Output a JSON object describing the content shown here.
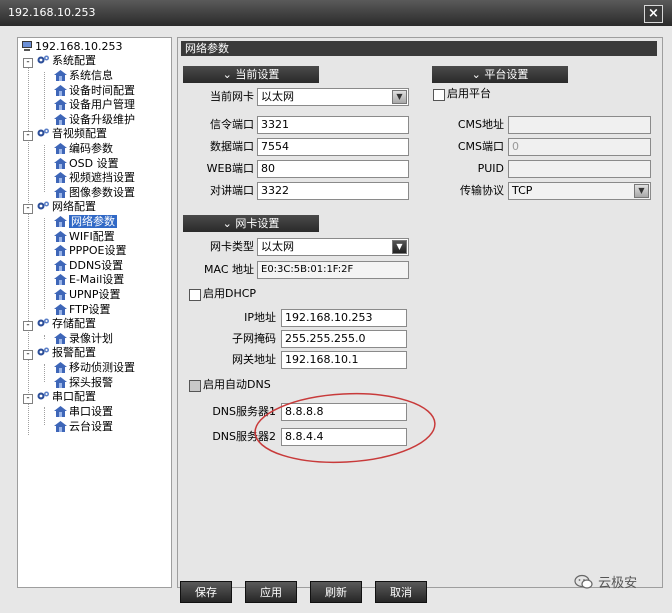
{
  "window": {
    "title": "192.168.10.253",
    "close_glyph": "×"
  },
  "tree": {
    "root": "192.168.10.253",
    "groups": [
      {
        "label": "系统配置",
        "expander": "-",
        "items": [
          "系统信息",
          "设备时间配置",
          "设备用户管理",
          "设备升级维护"
        ]
      },
      {
        "label": "音视频配置",
        "expander": "-",
        "items": [
          "编码参数",
          "OSD 设置",
          "视频遮挡设置",
          "图像参数设置"
        ]
      },
      {
        "label": "网络配置",
        "expander": "-",
        "items": [
          "网络参数",
          "WIFI配置",
          "PPPOE设置",
          "DDNS设置",
          "E-Mail设置",
          "UPNP设置",
          "FTP设置"
        ]
      },
      {
        "label": "存储配置",
        "expander": "-",
        "items": [
          "录像计划"
        ]
      },
      {
        "label": "报警配置",
        "expander": "-",
        "items": [
          "移动侦测设置",
          "探头报警"
        ]
      },
      {
        "label": "串口配置",
        "expander": "-",
        "items": [
          "串口设置",
          "云台设置"
        ]
      }
    ]
  },
  "panel": {
    "title": "网络参数",
    "current": {
      "header": "当前设置",
      "chevron": "⌄",
      "nic_label": "当前网卡",
      "nic_value": "以太网",
      "signal_port_label": "信令端口",
      "signal_port": "3321",
      "data_port_label": "数据端口",
      "data_port": "7554",
      "web_port_label": "WEB端口",
      "web_port": "80",
      "talk_port_label": "对讲端口",
      "talk_port": "3322"
    },
    "platform": {
      "header": "平台设置",
      "enable_label": "启用平台",
      "cms_addr_label": "CMS地址",
      "cms_addr": "",
      "cms_port_label": "CMS端口",
      "cms_port": "0",
      "puid_label": "PUID",
      "puid": "",
      "protocol_label": "传输协议",
      "protocol": "TCP"
    },
    "nic": {
      "header": "网卡设置",
      "type_label": "网卡类型",
      "type_value": "以太网",
      "mac_label": "MAC 地址",
      "mac": "E0:3C:5B:01:1F:2F",
      "dhcp_label": "启用DHCP",
      "ip_label": "IP地址",
      "ip": "192.168.10.253",
      "mask_label": "子网掩码",
      "mask": "255.255.255.0",
      "gateway_label": "网关地址",
      "gateway": "192.168.10.1",
      "auto_dns_label": "启用自动DNS",
      "dns1_label": "DNS服务器1",
      "dns1": "8.8.8.8",
      "dns2_label": "DNS服务器2",
      "dns2": "8.8.4.4"
    }
  },
  "buttons": {
    "save": "保存",
    "apply": "应用",
    "refresh": "刷新",
    "cancel": "取消"
  },
  "watermark": "云极安",
  "colors": {
    "selection": "#3169c6",
    "annotation": "#c83a3a",
    "titlebar": "#3a3a3a"
  }
}
